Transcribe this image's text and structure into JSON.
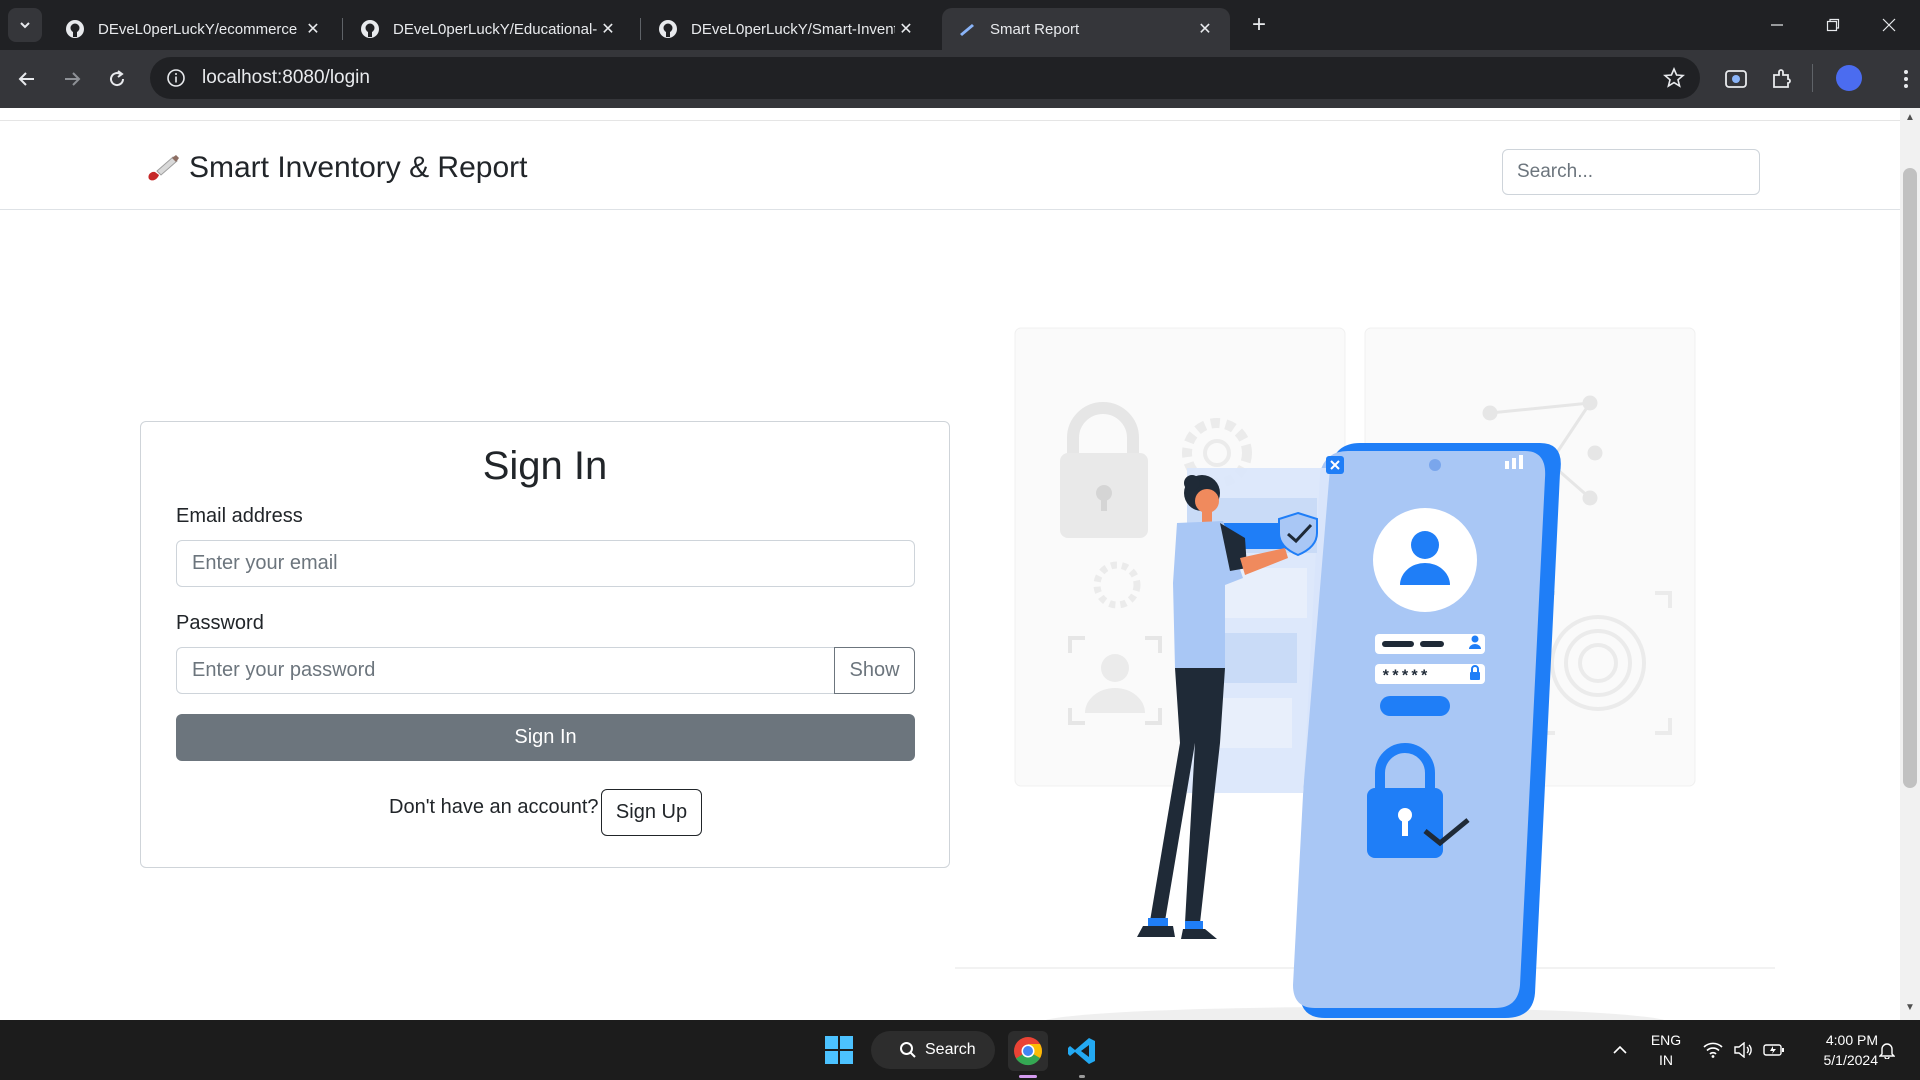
{
  "browser": {
    "tabs": [
      {
        "title": "DEveL0perLuckY/ecommerce",
        "active": false,
        "favicon": "github-icon"
      },
      {
        "title": "DEveL0perLuckY/Educational-ap",
        "active": false,
        "favicon": "github-icon"
      },
      {
        "title": "DEveL0perLuckY/Smart-Invento",
        "active": false,
        "favicon": "github-icon"
      },
      {
        "title": "Smart Report",
        "active": true,
        "favicon": "pen-icon"
      }
    ],
    "url": "localhost:8080/login"
  },
  "navbar": {
    "brand": "Smart Inventory & Report",
    "logo_icon": "paintbrush-icon",
    "search_placeholder": "Search..."
  },
  "login": {
    "title": "Sign In",
    "email_label": "Email address",
    "email_placeholder": "Enter your email",
    "password_label": "Password",
    "password_placeholder": "Enter your password",
    "show_label": "Show",
    "submit_label": "Sign In",
    "no_account_text": "Don't have an account?",
    "signup_label": "Sign Up"
  },
  "illustration": {
    "name": "login-security-illustration",
    "password_mask": "*****"
  },
  "taskbar": {
    "search_label": "Search",
    "language": "ENG",
    "region": "IN",
    "time": "4:00 PM",
    "date": "5/1/2024"
  },
  "colors": {
    "accent_blue": "#1f7ef7",
    "light_blue": "#a9c7f5",
    "button_gray": "#6c757d",
    "chrome_dark": "#202124"
  }
}
